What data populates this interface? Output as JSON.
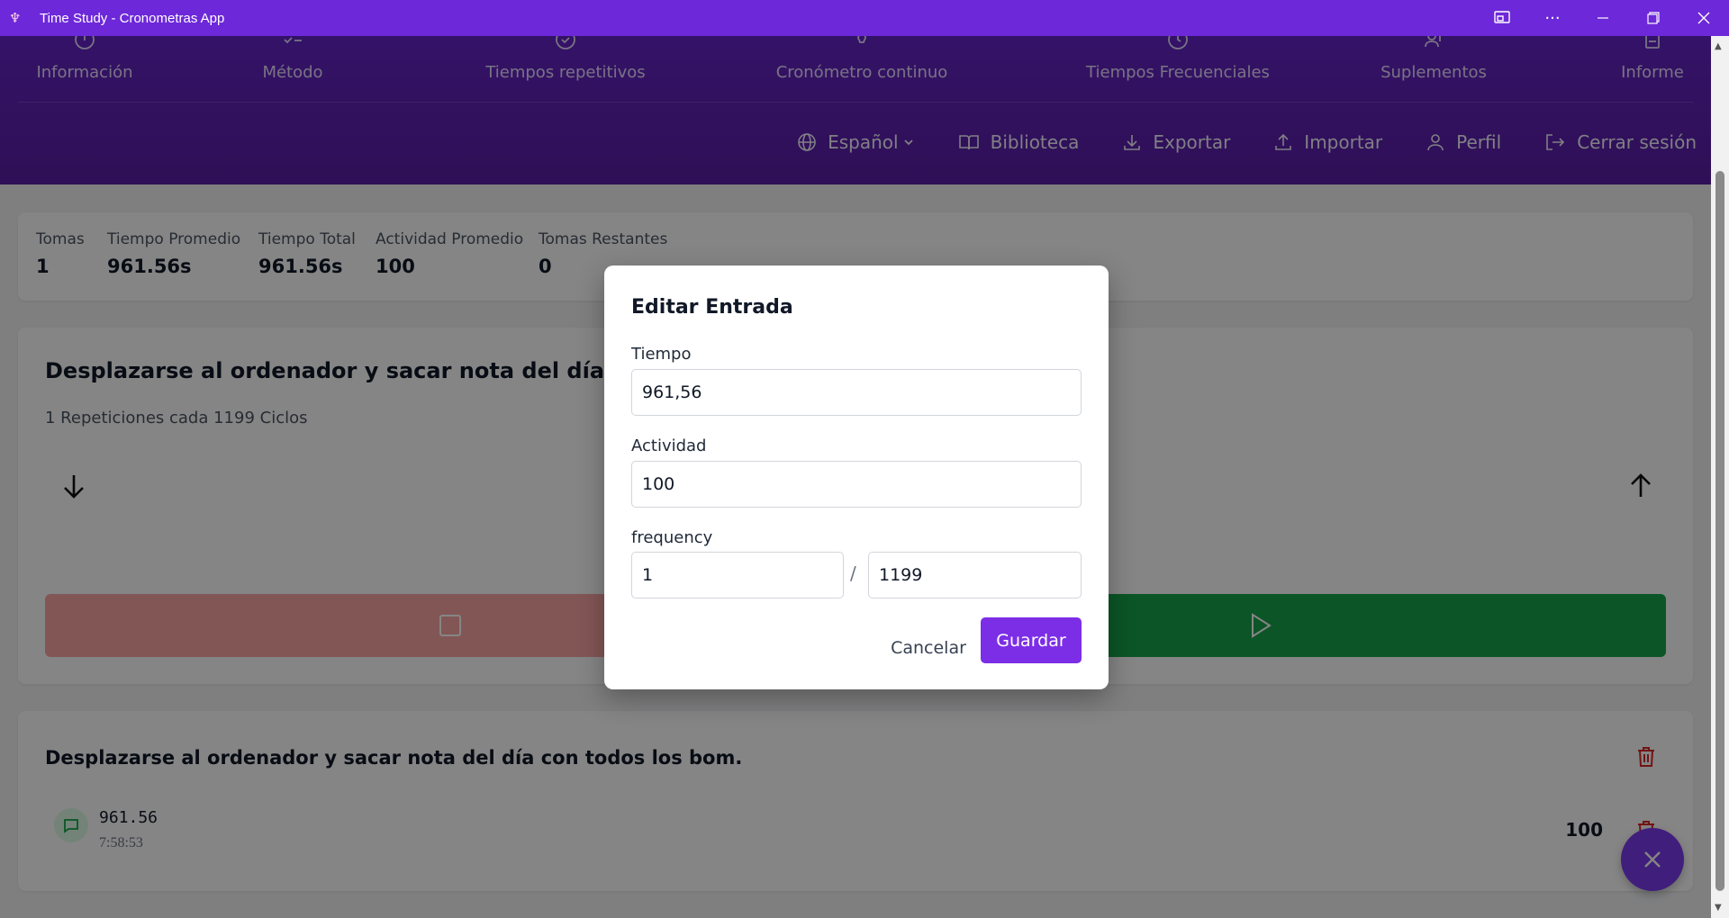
{
  "window": {
    "title": "Time Study - Cronometras App",
    "controls": [
      "screencast-icon",
      "more-icon",
      "minimize-icon",
      "restore-icon",
      "close-icon"
    ]
  },
  "nav": {
    "items": [
      {
        "label": "Información",
        "icon": "info-icon"
      },
      {
        "label": "Método",
        "icon": "list-check-icon"
      },
      {
        "label": "Tiempos repetitivos",
        "icon": "check-circle-icon"
      },
      {
        "label": "Cronómetro continuo",
        "icon": "lightbulb-icon"
      },
      {
        "label": "Tiempos Frecuenciales",
        "icon": "clock-icon"
      },
      {
        "label": "Suplementos",
        "icon": "user-plus-icon"
      },
      {
        "label": "Informe",
        "icon": "document-icon"
      }
    ]
  },
  "toolbar": {
    "language": "Español",
    "library": "Biblioteca",
    "export": "Exportar",
    "import": "Importar",
    "profile": "Perfil",
    "logout": "Cerrar sesión"
  },
  "stats": {
    "takes": {
      "label": "Tomas",
      "value": "1"
    },
    "avg_time": {
      "label": "Tiempo Promedio",
      "value": "961.56s"
    },
    "total_time": {
      "label": "Tiempo Total",
      "value": "961.56s"
    },
    "avg_activity": {
      "label": "Actividad Promedio",
      "value": "100"
    },
    "remaining": {
      "label": "Tomas Restantes",
      "value": "0"
    }
  },
  "task": {
    "title": "Desplazarse al ordenador y sacar nota del día con todos los bom.",
    "subtitle": "1 Repeticiones cada 1199 Ciclos"
  },
  "entries": {
    "title": "Desplazarse al ordenador y sacar nota del día con todos los bom.",
    "items": [
      {
        "time": "961.56",
        "clock": "7:58:53",
        "activity": "100"
      }
    ]
  },
  "modal": {
    "title": "Editar Entrada",
    "time_label": "Tiempo",
    "time_value": "961,56",
    "activity_label": "Actividad",
    "activity_value": "100",
    "frequency_label": "frequency",
    "freq_num": "1",
    "freq_sep": "/",
    "freq_den": "1199",
    "cancel": "Cancelar",
    "save": "Guardar"
  },
  "colors": {
    "titlebar": "#6d28d9",
    "header": "#5b21b6",
    "accent": "#7c3aed",
    "stop": "#fca5a5",
    "play": "#16a34a"
  }
}
